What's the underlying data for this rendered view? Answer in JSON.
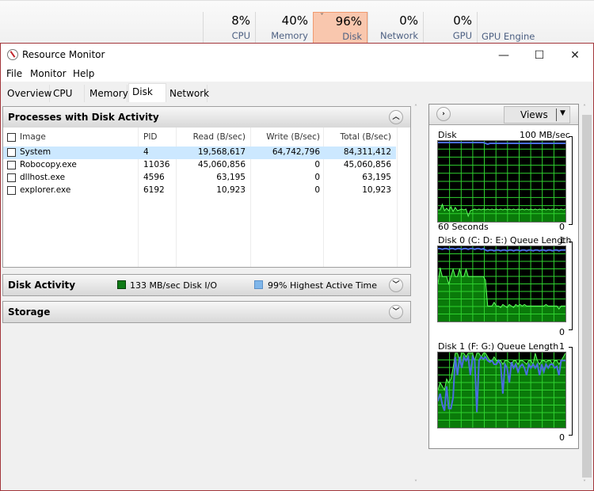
{
  "task_manager": {
    "columns": [
      {
        "percent": "8%",
        "label": "CPU",
        "active": false
      },
      {
        "percent": "40%",
        "label": "Memory",
        "active": false
      },
      {
        "percent": "96%",
        "label": "Disk",
        "active": true
      },
      {
        "percent": "0%",
        "label": "Network",
        "active": false
      },
      {
        "percent": "0%",
        "label": "GPU",
        "active": false
      }
    ],
    "gpu_engine_label": "GPU Engine",
    "active_color": "#f9c7ae"
  },
  "window": {
    "title": "Resource Monitor",
    "controls": {
      "minimize": "—",
      "maximize": "☐",
      "close": "✕"
    },
    "border_color": "#a2363b"
  },
  "menu": [
    "File",
    "Monitor",
    "Help"
  ],
  "tabs": [
    {
      "label": "Overview",
      "active": false
    },
    {
      "label": "CPU",
      "active": false
    },
    {
      "label": "Memory",
      "active": false
    },
    {
      "label": "Disk",
      "active": true
    },
    {
      "label": "Network",
      "active": false
    }
  ],
  "processes_section": {
    "title": "Processes with Disk Activity",
    "toggle_icon": "collapse-up",
    "columns": [
      "Image",
      "PID",
      "Read (B/sec)",
      "Write (B/sec)",
      "Total (B/sec)"
    ],
    "rows": [
      {
        "image": "System",
        "pid": "4",
        "read": "19,568,617",
        "write": "64,742,796",
        "total": "84,311,412",
        "selected": true
      },
      {
        "image": "Robocopy.exe",
        "pid": "11036",
        "read": "45,060,856",
        "write": "0",
        "total": "45,060,856",
        "selected": false
      },
      {
        "image": "dllhost.exe",
        "pid": "4596",
        "read": "63,195",
        "write": "0",
        "total": "63,195",
        "selected": false
      },
      {
        "image": "explorer.exe",
        "pid": "6192",
        "read": "10,923",
        "write": "0",
        "total": "10,923",
        "selected": false
      }
    ]
  },
  "disk_activity_section": {
    "title": "Disk Activity",
    "io_label": "133 MB/sec Disk I/O",
    "io_color": "#0f7a16",
    "active_time_label": "99% Highest Active Time",
    "active_time_color": "#7fb6ea"
  },
  "storage_section": {
    "title": "Storage"
  },
  "right_panel": {
    "views_label": "Views",
    "graphs": [
      {
        "title": "Disk",
        "max_label": "100 MB/sec",
        "time_label": "60 Seconds",
        "min_label": "0"
      },
      {
        "title": "Disk 0 (C: D: E:) Queue Length",
        "max_label": "1",
        "time_label": "",
        "min_label": "0"
      },
      {
        "title": "Disk 1 (F: G:) Queue Length",
        "max_label": "1",
        "time_label": "",
        "min_label": "0"
      }
    ]
  },
  "chart_data": [
    {
      "type": "area",
      "title": "Disk",
      "xlabel": "60 Seconds",
      "ylabel": "MB/sec",
      "ylim": [
        0,
        100
      ],
      "grid": true,
      "series": [
        {
          "name": "Disk I/O",
          "color": "#1fd11f",
          "values": [
            14,
            14,
            21,
            13,
            16,
            13,
            18,
            12,
            17,
            13,
            14,
            15,
            14,
            15,
            6,
            13,
            14,
            15,
            14,
            15,
            14,
            15,
            14,
            15,
            14,
            15,
            14,
            15,
            14,
            15,
            14,
            15,
            14,
            15,
            14,
            15,
            14,
            15,
            14,
            15,
            14,
            15,
            14,
            15,
            14,
            15,
            14,
            15,
            14,
            15,
            14,
            15,
            14,
            15,
            14,
            15,
            14,
            15,
            14,
            15
          ]
        },
        {
          "name": "Highest Active Time",
          "color": "#4a6de0",
          "values": [
            99,
            99,
            99,
            99,
            99,
            99,
            99,
            99,
            99,
            99,
            99,
            99,
            99,
            99,
            99,
            99,
            99,
            99,
            99,
            99,
            99,
            99,
            98,
            97,
            98,
            98,
            98,
            98,
            98,
            98,
            98,
            98,
            98,
            98,
            98,
            98,
            98,
            98,
            98,
            98,
            98,
            98,
            98,
            98,
            98,
            98,
            98,
            98,
            98,
            98,
            98,
            98,
            98,
            98,
            98,
            98,
            98,
            98,
            98,
            98
          ]
        }
      ]
    },
    {
      "type": "area",
      "title": "Disk 0 (C: D: E:) Queue Length",
      "xlabel": "60 Seconds",
      "ylim": [
        0,
        1
      ],
      "grid": true,
      "series": [
        {
          "name": "Queue Length",
          "color": "#1fd11f",
          "values": [
            0.5,
            0.72,
            0.6,
            0.6,
            0.6,
            0.5,
            0.6,
            0.7,
            0.6,
            0.6,
            0.7,
            0.6,
            0.6,
            0.7,
            0.6,
            0.6,
            0.6,
            0.6,
            0.6,
            0.6,
            0.6,
            0.6,
            0.55,
            0.2,
            0.2,
            0.2,
            0.25,
            0.2,
            0.2,
            0.18,
            0.22,
            0.2,
            0.18,
            0.22,
            0.2,
            0.18,
            0.22,
            0.2,
            0.22,
            0.2,
            0.22,
            0.2,
            0.2,
            0.2,
            0.2,
            0.2,
            0.2,
            0.2,
            0.2,
            0.2,
            0.22,
            0.2,
            0.2,
            0.2,
            0.2,
            0.2,
            0.16,
            0.2,
            0.2,
            0.2
          ]
        },
        {
          "name": "Active Time",
          "color": "#4a6de0",
          "values": [
            0.98,
            0.98,
            0.97,
            0.98,
            0.98,
            0.97,
            0.98,
            0.98,
            0.97,
            0.98,
            0.98,
            0.97,
            0.98,
            0.98,
            0.97,
            0.98,
            0.98,
            0.97,
            0.98,
            0.98,
            0.97,
            0.98,
            0.96,
            0.95,
            0.96,
            0.96,
            0.95,
            0.96,
            0.96,
            0.95,
            0.96,
            0.96,
            0.95,
            0.96,
            0.96,
            0.95,
            0.96,
            0.96,
            0.95,
            0.96,
            0.96,
            0.95,
            0.96,
            0.96,
            0.95,
            0.96,
            0.96,
            0.95,
            0.96,
            0.96,
            0.95,
            0.96,
            0.96,
            0.95,
            0.96,
            0.96,
            0.95,
            0.96,
            0.96,
            0.96
          ]
        }
      ]
    },
    {
      "type": "area",
      "title": "Disk 1 (F: G:) Queue Length",
      "xlabel": "60 Seconds",
      "ylim": [
        0,
        1
      ],
      "grid": true,
      "series": [
        {
          "name": "Queue Length",
          "color": "#1fd11f",
          "values": [
            0.5,
            0.6,
            0.55,
            0.5,
            0.65,
            0.6,
            0.65,
            0.8,
            1.0,
            1.0,
            0.9,
            1.0,
            1.0,
            0.95,
            1.0,
            1.0,
            1.0,
            0.9,
            1.0,
            1.0,
            0.95,
            1.0,
            1.0,
            0.95,
            0.9,
            0.9,
            0.95,
            0.9,
            0.9,
            0.9,
            0.85,
            0.9,
            0.9,
            0.88,
            0.85,
            0.9,
            0.9,
            0.85,
            0.9,
            0.9,
            0.88,
            0.85,
            0.9,
            0.9,
            0.85,
            1.0,
            0.9,
            0.85,
            0.9,
            0.9,
            0.88,
            0.9,
            0.9,
            0.85,
            0.9,
            0.9,
            0.85,
            0.9,
            0.95,
            1.0
          ]
        },
        {
          "name": "Active Time",
          "color": "#4a6de0",
          "values": [
            0.35,
            0.45,
            0.3,
            0.22,
            0.55,
            0.25,
            0.25,
            0.4,
            0.95,
            0.7,
            0.95,
            0.8,
            0.95,
            0.9,
            0.95,
            0.7,
            0.95,
            0.9,
            0.2,
            0.9,
            0.95,
            0.92,
            0.95,
            0.9,
            0.88,
            0.9,
            0.85,
            0.85,
            0.9,
            0.85,
            0.45,
            0.85,
            0.8,
            0.6,
            0.88,
            0.8,
            0.85,
            0.75,
            0.82,
            0.85,
            0.8,
            0.7,
            0.85,
            0.8,
            0.85,
            0.8,
            0.85,
            0.7,
            0.85,
            0.75,
            0.85,
            0.8,
            0.85,
            0.85,
            0.8,
            0.82,
            0.7,
            0.9,
            0.9,
            0.9
          ]
        }
      ]
    }
  ]
}
